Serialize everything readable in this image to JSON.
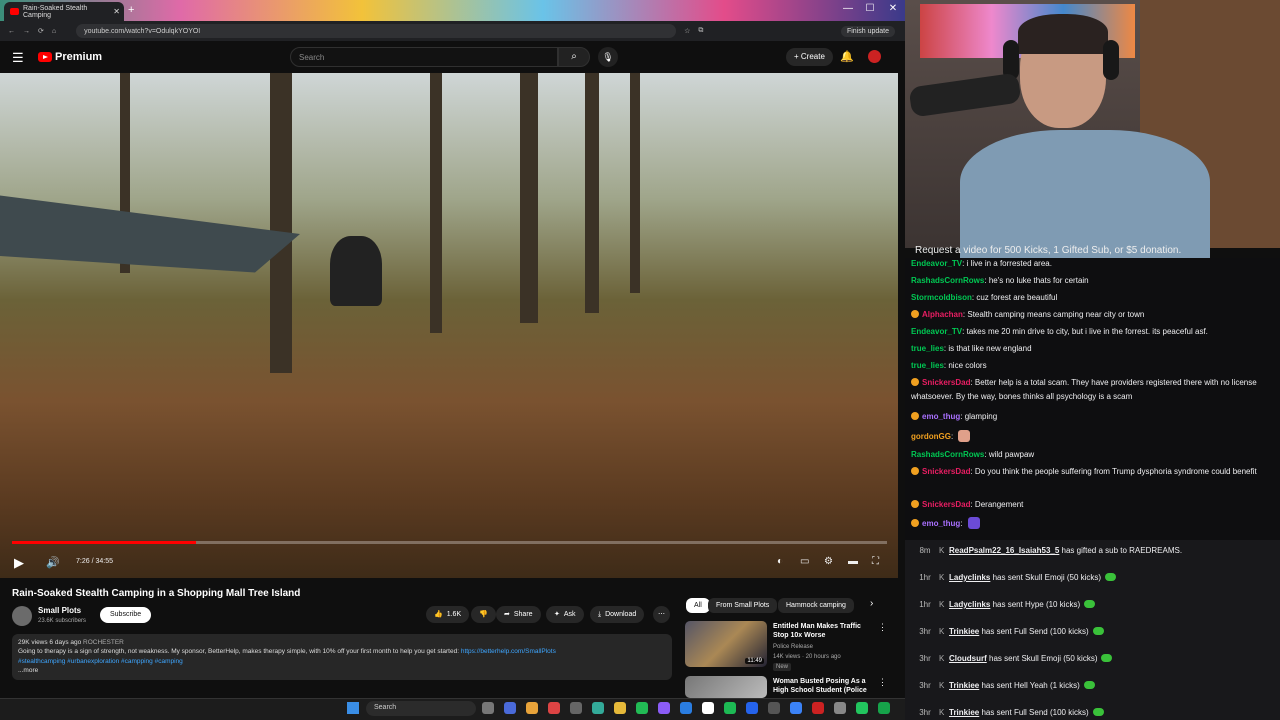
{
  "browser": {
    "tab_title": "Rain-Soaked Stealth Camping",
    "url": "youtube.com/watch?v=OdulqkYOYOI",
    "finish_update": "Finish update"
  },
  "youtube": {
    "brand": "Premium",
    "search_placeholder": "Search",
    "create_label": "Create"
  },
  "player": {
    "timecode": "7:26 / 34:55",
    "progress_fraction": 0.21
  },
  "video": {
    "title": "Rain-Soaked Stealth Camping in a Shopping Mall Tree Island",
    "channel": "Small Plots",
    "subscribers": "23.6K subscribers",
    "subscribe_label": "Subscribe",
    "likes": "1.6K",
    "share": "Share",
    "ask": "Ask",
    "download": "Download",
    "desc_meta": "29K views  6 days ago  ",
    "desc_location": "ROCHESTER",
    "desc_text": "Going to therapy is a sign of strength, not weakness. My sponsor, BetterHelp, makes therapy simple, with 10% off your first month to help you get started: ",
    "desc_link": "https://betterhelp.com/SmallPlots",
    "desc_tags": "#stealthcamping #urbanexploration #campping #camping",
    "desc_more": "...more"
  },
  "recs": {
    "chips": [
      "All",
      "From Small Plots",
      "Hammock camping"
    ],
    "items": [
      {
        "title": "Entitled Man Makes Traffic Stop 10x Worse",
        "channel": "Police Release",
        "meta": "14K views · 20 hours ago",
        "badge": "New",
        "duration": "11:49"
      },
      {
        "title": "Woman Busted Posing As a High School Student (Police ...",
        "channel": "",
        "meta": "",
        "badge": "",
        "duration": ""
      }
    ]
  },
  "taskbar": {
    "search": "Search"
  },
  "stream": {
    "banner": "Request a video for 500 Kicks, 1 Gifted Sub, or $5 donation.",
    "chat": [
      {
        "name": "Endeavor_TV",
        "text": "i live in a forrested area.",
        "color": "#00c853",
        "badge": false
      },
      {
        "name": "RashadsCornRows",
        "text": "he's no luke thats for certain",
        "color": "#00c853",
        "badge": false
      },
      {
        "name": "Stormcoldbison",
        "text": "cuz forest are beautiful",
        "color": "#00c853",
        "badge": false
      },
      {
        "name": "Alphachan",
        "text": "Stealth camping means camping near city or town",
        "color": "#e91e63",
        "badge": true
      },
      {
        "name": "Endeavor_TV",
        "text": "takes me 20 min drive to city, but i live in the forrest. its peaceful asf.",
        "color": "#00c853",
        "badge": false
      },
      {
        "name": "true_lies",
        "text": "is that like new england",
        "color": "#00c853",
        "badge": false
      },
      {
        "name": "true_lies",
        "text": "nice colors",
        "color": "#00c853",
        "badge": false
      },
      {
        "name": "SnickersDad",
        "text": "Better help is a total scam. They have providers registered there with no license whatsoever. By the way, bones thinks all psychology is a scam",
        "color": "#e91e63",
        "badge": true
      },
      {
        "name": "emo_thug",
        "text": "glamping",
        "color": "#a970ff",
        "badge": true
      },
      {
        "name": "gordonGG",
        "text": "",
        "color": "#f0a020",
        "badge": false
      },
      {
        "name": "RashadsCornRows",
        "text": "wild pawpaw",
        "color": "#00c853",
        "badge": false
      },
      {
        "name": "SnickersDad",
        "text": "Do you think the people suffering from Trump dysphoria syndrome could benefit",
        "color": "#e91e63",
        "badge": true
      },
      {
        "name": "SnickersDad",
        "text": "Derangement",
        "color": "#e91e63",
        "badge": true
      },
      {
        "name": "emo_thug",
        "text": "",
        "color": "#a970ff",
        "badge": true
      }
    ],
    "events": [
      {
        "time": "8m",
        "user": "ReadPsalm22_16_Isaiah53_5",
        "text": " has gifted a sub to RAEDREAMS.",
        "gem": false
      },
      {
        "time": "1hr",
        "user": "Ladyclinks",
        "text": " has sent Skull Emoji (50 kicks)",
        "gem": true
      },
      {
        "time": "1hr",
        "user": "Ladyclinks",
        "text": " has sent Hype (10 kicks)",
        "gem": true
      },
      {
        "time": "3hr",
        "user": "Trinkiee",
        "text": " has sent Full Send (100 kicks)",
        "gem": true
      },
      {
        "time": "3hr",
        "user": "Cloudsurf",
        "text": " has sent Skull Emoji (50 kicks)",
        "gem": true
      },
      {
        "time": "3hr",
        "user": "Trinkiee",
        "text": " has sent Hell Yeah (1 kicks)",
        "gem": true
      },
      {
        "time": "3hr",
        "user": "Trinkiee",
        "text": " has sent Full Send (100 kicks)",
        "gem": true
      }
    ]
  }
}
